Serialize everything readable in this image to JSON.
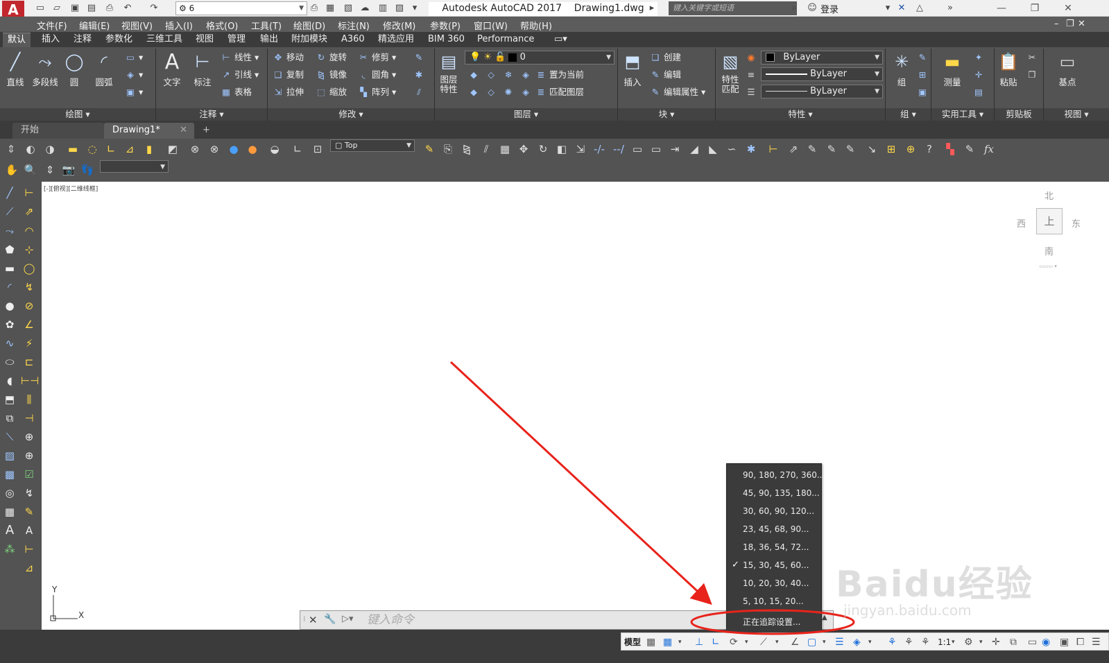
{
  "titlebar": {
    "logo": "A",
    "workspace": "6",
    "app_title": "Autodesk AutoCAD 2017",
    "doc_title": "Drawing1.dwg",
    "search_placeholder": "键入关键字或短语",
    "login": "登录"
  },
  "menubar": [
    "文件(F)",
    "编辑(E)",
    "视图(V)",
    "插入(I)",
    "格式(O)",
    "工具(T)",
    "绘图(D)",
    "标注(N)",
    "修改(M)",
    "参数(P)",
    "窗口(W)",
    "帮助(H)"
  ],
  "ribbon_tabs": [
    "默认",
    "插入",
    "注释",
    "参数化",
    "三维工具",
    "视图",
    "管理",
    "输出",
    "附加模块",
    "A360",
    "精选应用",
    "BIM 360",
    "Performance"
  ],
  "ribbon": {
    "draw": {
      "title": "绘图",
      "line": "直线",
      "polyline": "多段线",
      "circle": "圆",
      "arc": "圆弧"
    },
    "annotation": {
      "title": "注释",
      "text": "文字",
      "dimension": "标注",
      "linear": "线性",
      "leader": "引线",
      "table": "表格"
    },
    "modify": {
      "title": "修改",
      "move": "移动",
      "rotate": "旋转",
      "trim": "修剪",
      "copy": "复制",
      "mirror": "镜像",
      "fillet": "圆角",
      "stretch": "拉伸",
      "scale": "缩放",
      "array": "阵列"
    },
    "layers": {
      "title": "图层",
      "layer_props": "图层特性",
      "layer_value": "0",
      "set_current": "置为当前",
      "match_layer": "匹配图层"
    },
    "block": {
      "title": "块",
      "insert": "插入",
      "create": "创建",
      "edit": "编辑",
      "edit_attr": "编辑属性"
    },
    "properties": {
      "title": "特性",
      "match": "特性匹配",
      "color": "ByLayer",
      "linetype": "ByLayer",
      "lineweight": "ByLayer"
    },
    "groups": {
      "title": "组",
      "group": "组"
    },
    "utilities": {
      "title": "实用工具",
      "measure": "测量"
    },
    "clipboard": {
      "title": "剪贴板",
      "paste": "粘贴"
    },
    "view": {
      "title": "视图",
      "base": "基点"
    }
  },
  "file_tabs": [
    {
      "label": "开始"
    },
    {
      "label": "Drawing1*"
    }
  ],
  "toolbar": {
    "view_combo": "Top"
  },
  "viewport": {
    "label": "[-][俯视][二维线框]"
  },
  "viewcube": {
    "north": "北",
    "south": "南",
    "east": "东",
    "west": "西",
    "top": "上"
  },
  "ucs": {
    "x": "X",
    "y": "Y"
  },
  "command": {
    "placeholder": "键入命令"
  },
  "polar_menu": {
    "items": [
      {
        "label": "90, 180, 270, 360...",
        "checked": false
      },
      {
        "label": "45, 90, 135, 180...",
        "checked": false
      },
      {
        "label": "30, 60, 90, 120...",
        "checked": false
      },
      {
        "label": "23, 45, 68, 90...",
        "checked": false
      },
      {
        "label": "18, 36, 54, 72...",
        "checked": false
      },
      {
        "label": "15, 30, 45, 60...",
        "checked": true
      },
      {
        "label": "10, 20, 30, 40...",
        "checked": false
      },
      {
        "label": "5, 10, 15, 20...",
        "checked": false
      }
    ],
    "settings": "正在追踪设置..."
  },
  "statusbar": {
    "model": "模型",
    "scale": "1:1"
  },
  "watermark": {
    "text": "Baidu经验",
    "url": "jingyan.baidu.com"
  },
  "colors": {
    "accent": "#1e6fd9",
    "annotation": "#e8231b",
    "ribbon_bg": "#535353"
  }
}
